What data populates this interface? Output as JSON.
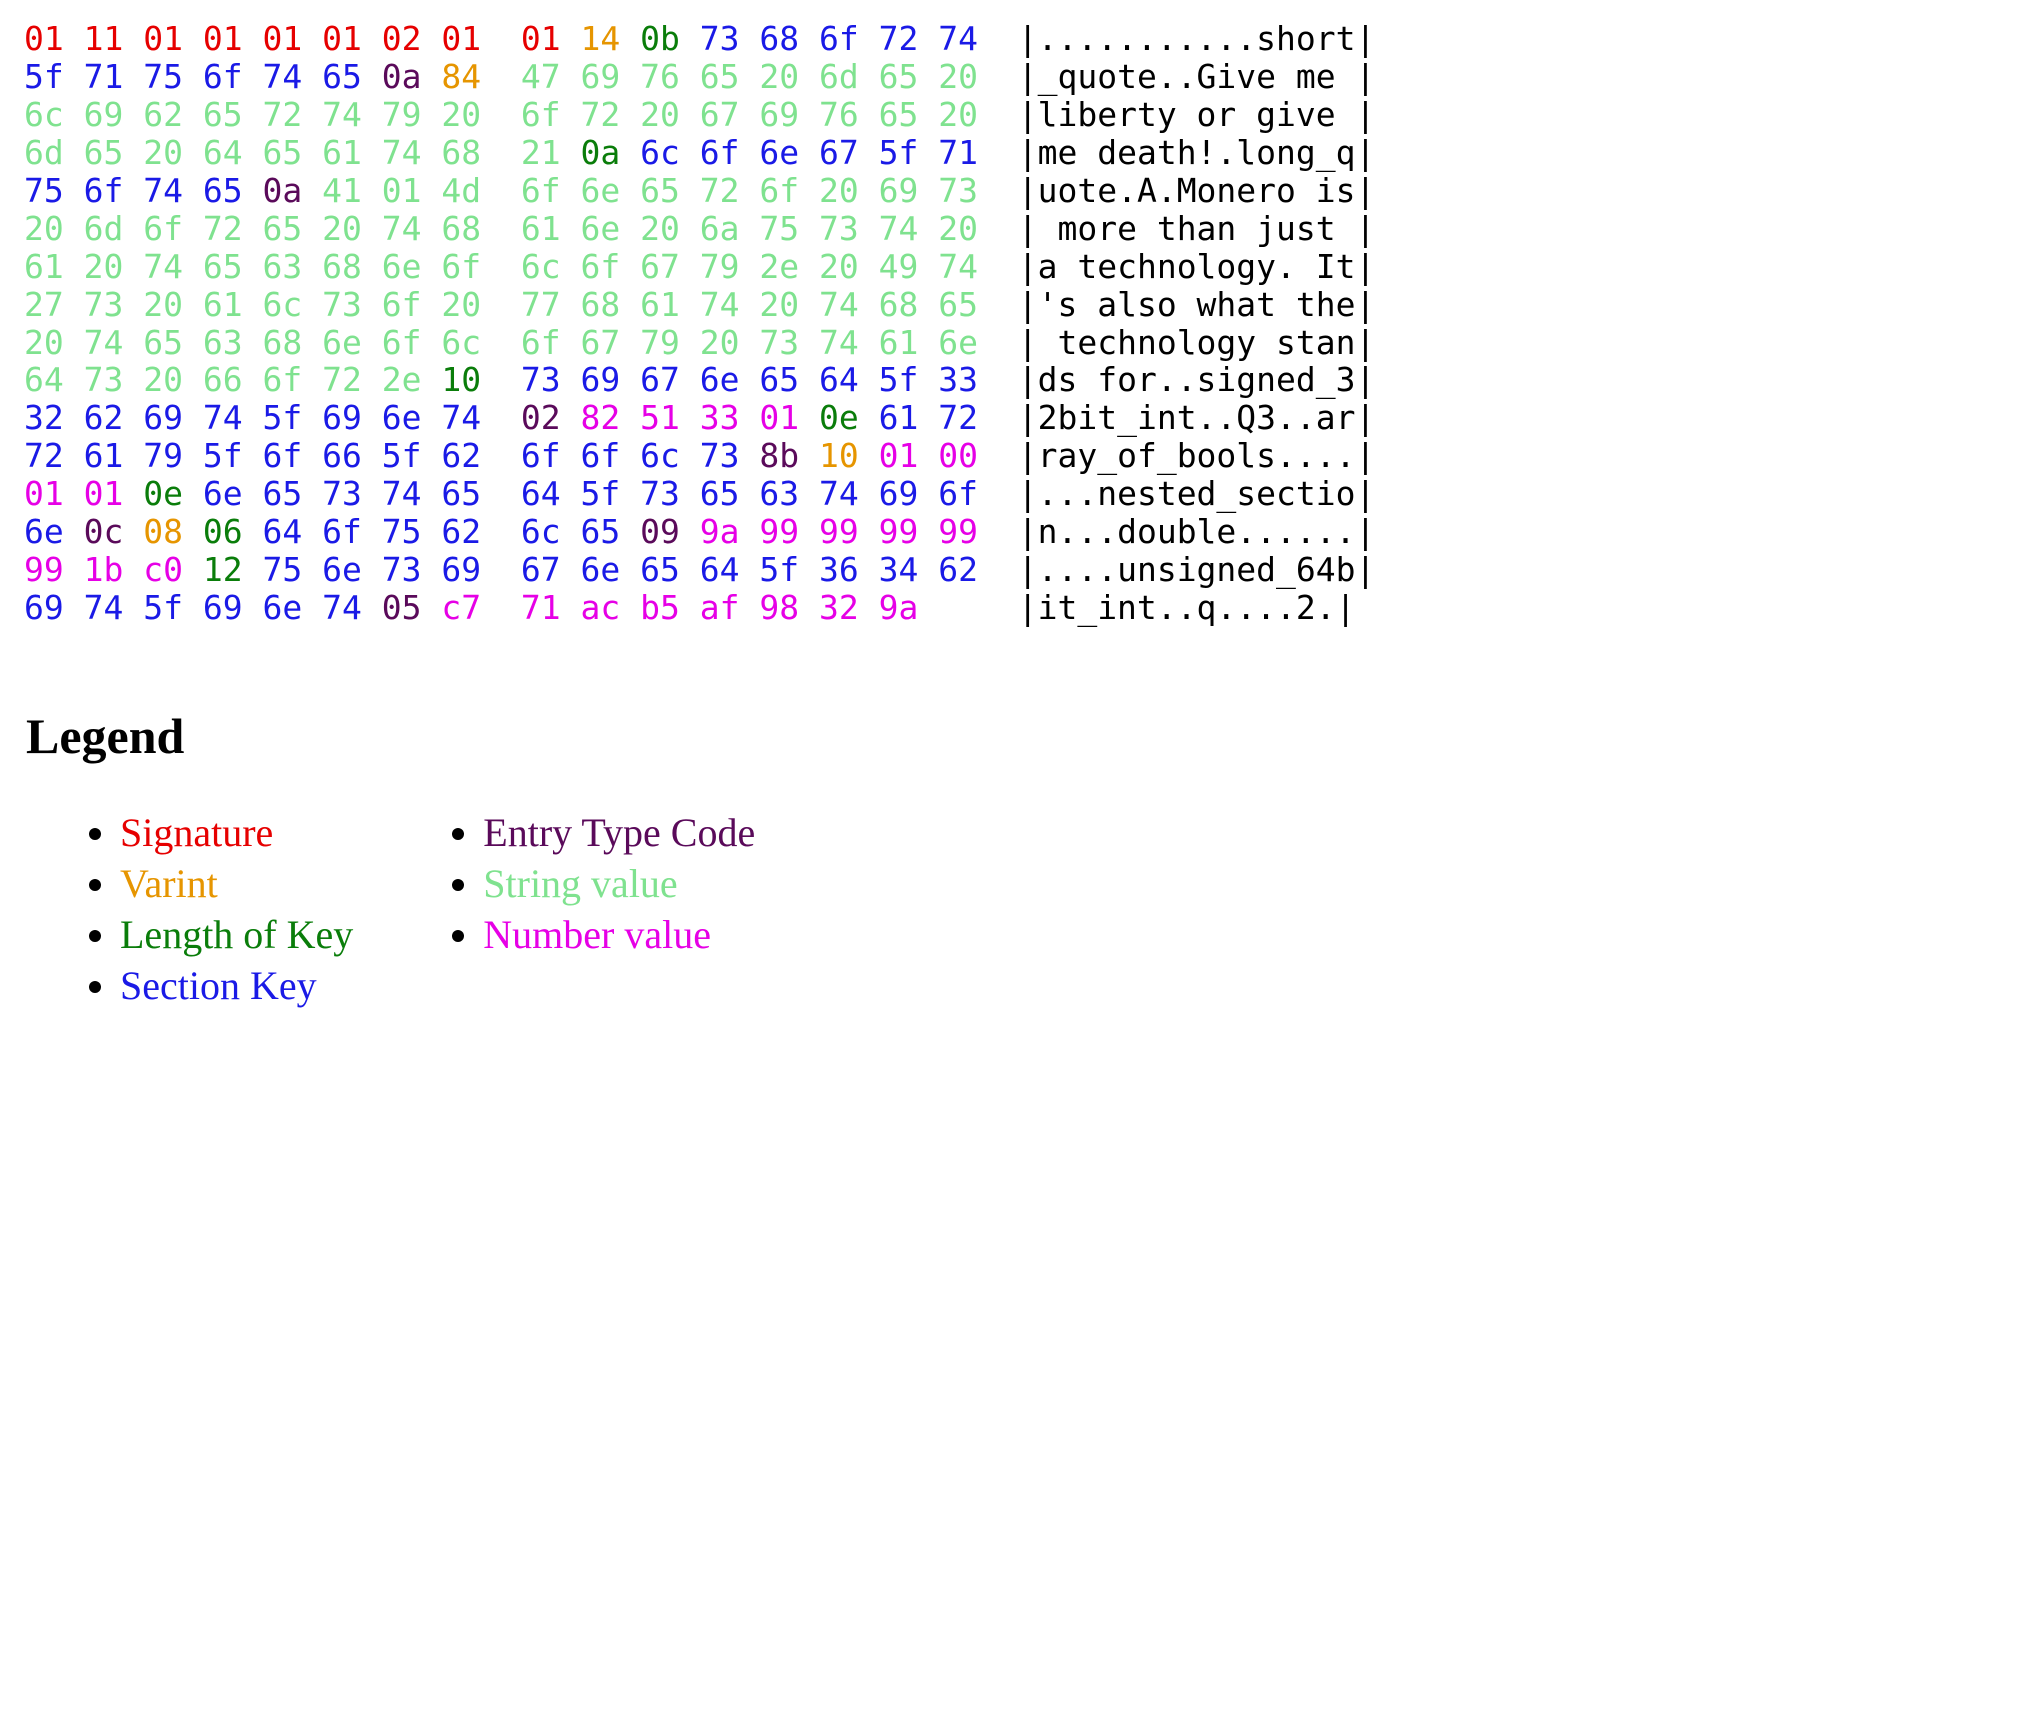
{
  "colors": {
    "signature": "#e60000",
    "varint": "#e69500",
    "len_key": "#0a7d0a",
    "section_key": "#1a1ae6",
    "entry_type": "#5a0a5a",
    "string_value": "#7fe28f",
    "number_value": "#e600e6",
    "ascii": "#000000"
  },
  "hex_rows": [
    {
      "left": [
        [
          "01",
          "sig"
        ],
        [
          "11",
          "sig"
        ],
        [
          "01",
          "sig"
        ],
        [
          "01",
          "sig"
        ],
        [
          "01",
          "sig"
        ],
        [
          "01",
          "sig"
        ],
        [
          "02",
          "sig"
        ],
        [
          "01",
          "sig"
        ]
      ],
      "right": [
        [
          "01",
          "sig"
        ],
        [
          "14",
          "var"
        ],
        [
          "0b",
          "len"
        ],
        [
          "73",
          "key"
        ],
        [
          "68",
          "key"
        ],
        [
          "6f",
          "key"
        ],
        [
          "72",
          "key"
        ],
        [
          "74",
          "key"
        ]
      ],
      "ascii": "|...........short|"
    },
    {
      "left": [
        [
          "5f",
          "key"
        ],
        [
          "71",
          "key"
        ],
        [
          "75",
          "key"
        ],
        [
          "6f",
          "key"
        ],
        [
          "74",
          "key"
        ],
        [
          "65",
          "key"
        ],
        [
          "0a",
          "type"
        ],
        [
          "84",
          "var"
        ]
      ],
      "right": [
        [
          "47",
          "str"
        ],
        [
          "69",
          "str"
        ],
        [
          "76",
          "str"
        ],
        [
          "65",
          "str"
        ],
        [
          "20",
          "str"
        ],
        [
          "6d",
          "str"
        ],
        [
          "65",
          "str"
        ],
        [
          "20",
          "str"
        ]
      ],
      "ascii": "|_quote..Give me |"
    },
    {
      "left": [
        [
          "6c",
          "str"
        ],
        [
          "69",
          "str"
        ],
        [
          "62",
          "str"
        ],
        [
          "65",
          "str"
        ],
        [
          "72",
          "str"
        ],
        [
          "74",
          "str"
        ],
        [
          "79",
          "str"
        ],
        [
          "20",
          "str"
        ]
      ],
      "right": [
        [
          "6f",
          "str"
        ],
        [
          "72",
          "str"
        ],
        [
          "20",
          "str"
        ],
        [
          "67",
          "str"
        ],
        [
          "69",
          "str"
        ],
        [
          "76",
          "str"
        ],
        [
          "65",
          "str"
        ],
        [
          "20",
          "str"
        ]
      ],
      "ascii": "|liberty or give |"
    },
    {
      "left": [
        [
          "6d",
          "str"
        ],
        [
          "65",
          "str"
        ],
        [
          "20",
          "str"
        ],
        [
          "64",
          "str"
        ],
        [
          "65",
          "str"
        ],
        [
          "61",
          "str"
        ],
        [
          "74",
          "str"
        ],
        [
          "68",
          "str"
        ]
      ],
      "right": [
        [
          "21",
          "str"
        ],
        [
          "0a",
          "len"
        ],
        [
          "6c",
          "key"
        ],
        [
          "6f",
          "key"
        ],
        [
          "6e",
          "key"
        ],
        [
          "67",
          "key"
        ],
        [
          "5f",
          "key"
        ],
        [
          "71",
          "key"
        ]
      ],
      "ascii": "|me death!.long_q|"
    },
    {
      "left": [
        [
          "75",
          "key"
        ],
        [
          "6f",
          "key"
        ],
        [
          "74",
          "key"
        ],
        [
          "65",
          "key"
        ],
        [
          "0a",
          "type"
        ],
        [
          "41",
          "str"
        ],
        [
          "01",
          "str"
        ],
        [
          "4d",
          "str"
        ]
      ],
      "right": [
        [
          "6f",
          "str"
        ],
        [
          "6e",
          "str"
        ],
        [
          "65",
          "str"
        ],
        [
          "72",
          "str"
        ],
        [
          "6f",
          "str"
        ],
        [
          "20",
          "str"
        ],
        [
          "69",
          "str"
        ],
        [
          "73",
          "str"
        ]
      ],
      "ascii": "|uote.A.Monero is|"
    },
    {
      "left": [
        [
          "20",
          "str"
        ],
        [
          "6d",
          "str"
        ],
        [
          "6f",
          "str"
        ],
        [
          "72",
          "str"
        ],
        [
          "65",
          "str"
        ],
        [
          "20",
          "str"
        ],
        [
          "74",
          "str"
        ],
        [
          "68",
          "str"
        ]
      ],
      "right": [
        [
          "61",
          "str"
        ],
        [
          "6e",
          "str"
        ],
        [
          "20",
          "str"
        ],
        [
          "6a",
          "str"
        ],
        [
          "75",
          "str"
        ],
        [
          "73",
          "str"
        ],
        [
          "74",
          "str"
        ],
        [
          "20",
          "str"
        ]
      ],
      "ascii": "| more than just |"
    },
    {
      "left": [
        [
          "61",
          "str"
        ],
        [
          "20",
          "str"
        ],
        [
          "74",
          "str"
        ],
        [
          "65",
          "str"
        ],
        [
          "63",
          "str"
        ],
        [
          "68",
          "str"
        ],
        [
          "6e",
          "str"
        ],
        [
          "6f",
          "str"
        ]
      ],
      "right": [
        [
          "6c",
          "str"
        ],
        [
          "6f",
          "str"
        ],
        [
          "67",
          "str"
        ],
        [
          "79",
          "str"
        ],
        [
          "2e",
          "str"
        ],
        [
          "20",
          "str"
        ],
        [
          "49",
          "str"
        ],
        [
          "74",
          "str"
        ]
      ],
      "ascii": "|a technology. It|"
    },
    {
      "left": [
        [
          "27",
          "str"
        ],
        [
          "73",
          "str"
        ],
        [
          "20",
          "str"
        ],
        [
          "61",
          "str"
        ],
        [
          "6c",
          "str"
        ],
        [
          "73",
          "str"
        ],
        [
          "6f",
          "str"
        ],
        [
          "20",
          "str"
        ]
      ],
      "right": [
        [
          "77",
          "str"
        ],
        [
          "68",
          "str"
        ],
        [
          "61",
          "str"
        ],
        [
          "74",
          "str"
        ],
        [
          "20",
          "str"
        ],
        [
          "74",
          "str"
        ],
        [
          "68",
          "str"
        ],
        [
          "65",
          "str"
        ]
      ],
      "ascii": "|'s also what the|"
    },
    {
      "left": [
        [
          "20",
          "str"
        ],
        [
          "74",
          "str"
        ],
        [
          "65",
          "str"
        ],
        [
          "63",
          "str"
        ],
        [
          "68",
          "str"
        ],
        [
          "6e",
          "str"
        ],
        [
          "6f",
          "str"
        ],
        [
          "6c",
          "str"
        ]
      ],
      "right": [
        [
          "6f",
          "str"
        ],
        [
          "67",
          "str"
        ],
        [
          "79",
          "str"
        ],
        [
          "20",
          "str"
        ],
        [
          "73",
          "str"
        ],
        [
          "74",
          "str"
        ],
        [
          "61",
          "str"
        ],
        [
          "6e",
          "str"
        ]
      ],
      "ascii": "| technology stan|"
    },
    {
      "left": [
        [
          "64",
          "str"
        ],
        [
          "73",
          "str"
        ],
        [
          "20",
          "str"
        ],
        [
          "66",
          "str"
        ],
        [
          "6f",
          "str"
        ],
        [
          "72",
          "str"
        ],
        [
          "2e",
          "str"
        ],
        [
          "10",
          "len"
        ]
      ],
      "right": [
        [
          "73",
          "key"
        ],
        [
          "69",
          "key"
        ],
        [
          "67",
          "key"
        ],
        [
          "6e",
          "key"
        ],
        [
          "65",
          "key"
        ],
        [
          "64",
          "key"
        ],
        [
          "5f",
          "key"
        ],
        [
          "33",
          "key"
        ]
      ],
      "ascii": "|ds for..signed_3|"
    },
    {
      "left": [
        [
          "32",
          "key"
        ],
        [
          "62",
          "key"
        ],
        [
          "69",
          "key"
        ],
        [
          "74",
          "key"
        ],
        [
          "5f",
          "key"
        ],
        [
          "69",
          "key"
        ],
        [
          "6e",
          "key"
        ],
        [
          "74",
          "key"
        ]
      ],
      "right": [
        [
          "02",
          "type"
        ],
        [
          "82",
          "num"
        ],
        [
          "51",
          "num"
        ],
        [
          "33",
          "num"
        ],
        [
          "01",
          "num"
        ],
        [
          "0e",
          "len"
        ],
        [
          "61",
          "key"
        ],
        [
          "72",
          "key"
        ]
      ],
      "ascii": "|2bit_int..Q3..ar|"
    },
    {
      "left": [
        [
          "72",
          "key"
        ],
        [
          "61",
          "key"
        ],
        [
          "79",
          "key"
        ],
        [
          "5f",
          "key"
        ],
        [
          "6f",
          "key"
        ],
        [
          "66",
          "key"
        ],
        [
          "5f",
          "key"
        ],
        [
          "62",
          "key"
        ]
      ],
      "right": [
        [
          "6f",
          "key"
        ],
        [
          "6f",
          "key"
        ],
        [
          "6c",
          "key"
        ],
        [
          "73",
          "key"
        ],
        [
          "8b",
          "type"
        ],
        [
          "10",
          "var"
        ],
        [
          "01",
          "num"
        ],
        [
          "00",
          "num"
        ]
      ],
      "ascii": "|ray_of_bools....|"
    },
    {
      "left": [
        [
          "01",
          "num"
        ],
        [
          "01",
          "num"
        ],
        [
          "0e",
          "len"
        ],
        [
          "6e",
          "key"
        ],
        [
          "65",
          "key"
        ],
        [
          "73",
          "key"
        ],
        [
          "74",
          "key"
        ],
        [
          "65",
          "key"
        ]
      ],
      "right": [
        [
          "64",
          "key"
        ],
        [
          "5f",
          "key"
        ],
        [
          "73",
          "key"
        ],
        [
          "65",
          "key"
        ],
        [
          "63",
          "key"
        ],
        [
          "74",
          "key"
        ],
        [
          "69",
          "key"
        ],
        [
          "6f",
          "key"
        ]
      ],
      "ascii": "|...nested_sectio|"
    },
    {
      "left": [
        [
          "6e",
          "key"
        ],
        [
          "0c",
          "type"
        ],
        [
          "08",
          "var"
        ],
        [
          "06",
          "len"
        ],
        [
          "64",
          "key"
        ],
        [
          "6f",
          "key"
        ],
        [
          "75",
          "key"
        ],
        [
          "62",
          "key"
        ]
      ],
      "right": [
        [
          "6c",
          "key"
        ],
        [
          "65",
          "key"
        ],
        [
          "09",
          "type"
        ],
        [
          "9a",
          "num"
        ],
        [
          "99",
          "num"
        ],
        [
          "99",
          "num"
        ],
        [
          "99",
          "num"
        ],
        [
          "99",
          "num"
        ]
      ],
      "ascii": "|n...double......|"
    },
    {
      "left": [
        [
          "99",
          "num"
        ],
        [
          "1b",
          "num"
        ],
        [
          "c0",
          "num"
        ],
        [
          "12",
          "len"
        ],
        [
          "75",
          "key"
        ],
        [
          "6e",
          "key"
        ],
        [
          "73",
          "key"
        ],
        [
          "69",
          "key"
        ]
      ],
      "right": [
        [
          "67",
          "key"
        ],
        [
          "6e",
          "key"
        ],
        [
          "65",
          "key"
        ],
        [
          "64",
          "key"
        ],
        [
          "5f",
          "key"
        ],
        [
          "36",
          "key"
        ],
        [
          "34",
          "key"
        ],
        [
          "62",
          "key"
        ]
      ],
      "ascii": "|....unsigned_64b|"
    },
    {
      "left": [
        [
          "69",
          "key"
        ],
        [
          "74",
          "key"
        ],
        [
          "5f",
          "key"
        ],
        [
          "69",
          "key"
        ],
        [
          "6e",
          "key"
        ],
        [
          "74",
          "key"
        ],
        [
          "05",
          "type"
        ],
        [
          "c7",
          "num"
        ]
      ],
      "right": [
        [
          "71",
          "num"
        ],
        [
          "ac",
          "num"
        ],
        [
          "b5",
          "num"
        ],
        [
          "af",
          "num"
        ],
        [
          "98",
          "num"
        ],
        [
          "32",
          "num"
        ],
        [
          "9a",
          "num"
        ]
      ],
      "ascii": "|it_int..q....2.|"
    }
  ],
  "legend": {
    "title": "Legend",
    "col1": [
      {
        "label": "Signature",
        "cls": "l-sig"
      },
      {
        "label": "Varint",
        "cls": "l-var"
      },
      {
        "label": "Length of Key",
        "cls": "l-len"
      },
      {
        "label": "Section Key",
        "cls": "l-key"
      }
    ],
    "col2": [
      {
        "label": "Entry Type Code",
        "cls": "l-type"
      },
      {
        "label": "String value",
        "cls": "l-str"
      },
      {
        "label": "Number value",
        "cls": "l-num"
      }
    ]
  }
}
